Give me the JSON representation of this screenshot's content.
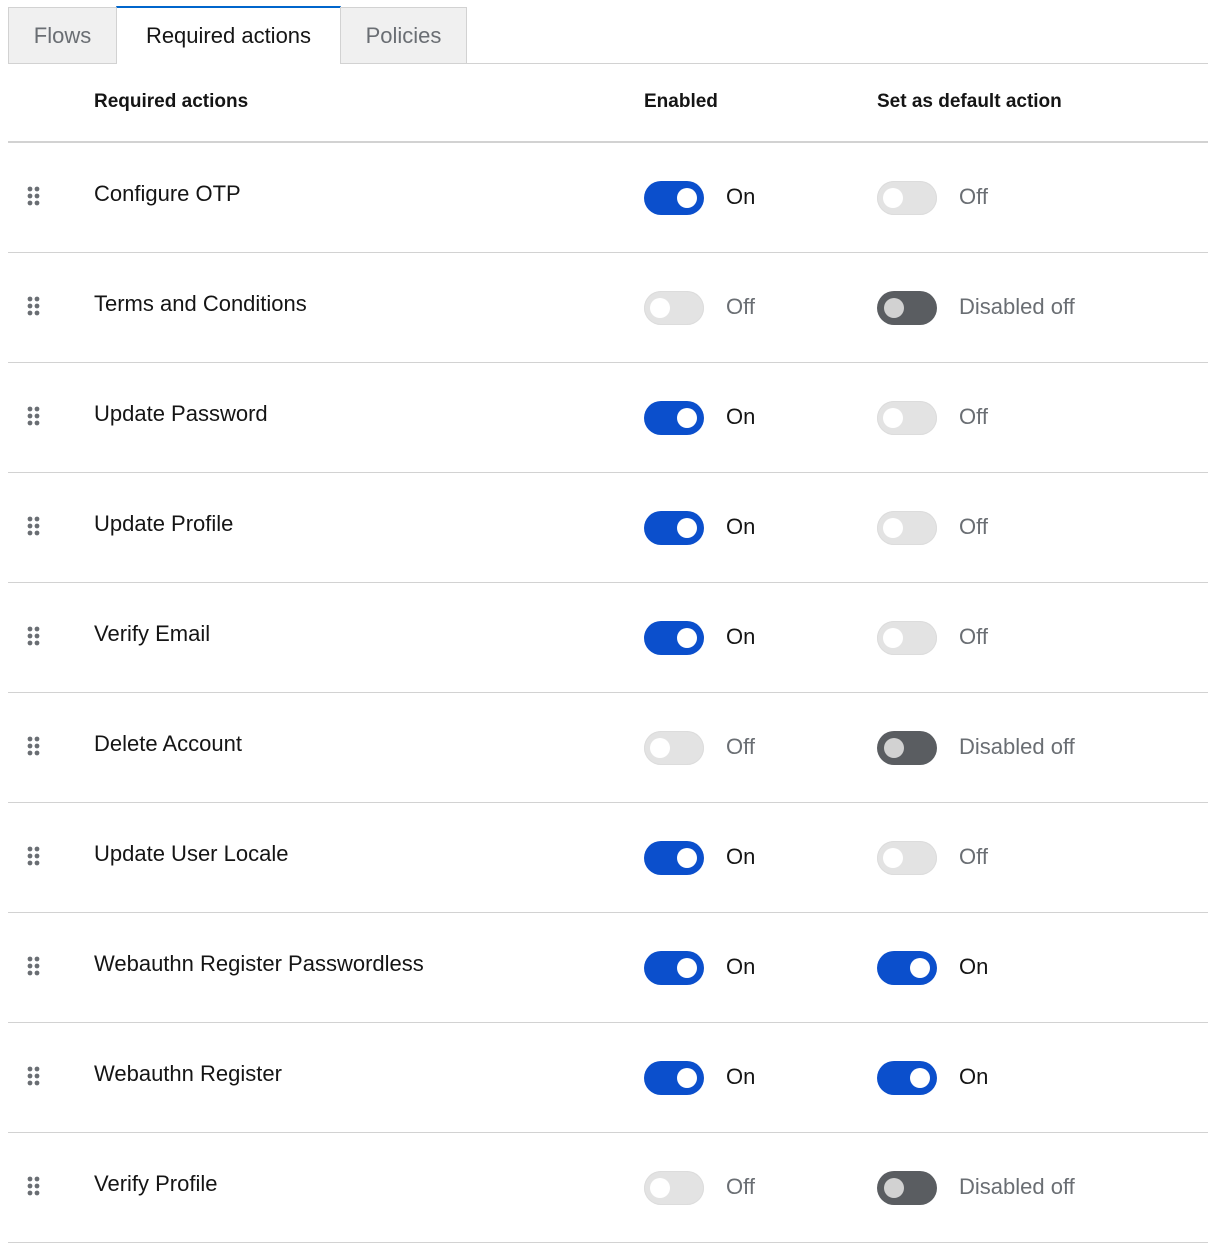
{
  "tabs": [
    {
      "label": "Flows",
      "active": false
    },
    {
      "label": "Required actions",
      "active": true
    },
    {
      "label": "Policies",
      "active": false
    }
  ],
  "table": {
    "headers": {
      "name": "Required actions",
      "enabled": "Enabled",
      "default": "Set as default action"
    },
    "rows": [
      {
        "name": "Configure OTP",
        "enabled": {
          "state": "on",
          "label": "On"
        },
        "default": {
          "state": "off",
          "label": "Off"
        }
      },
      {
        "name": "Terms and Conditions",
        "enabled": {
          "state": "off",
          "label": "Off"
        },
        "default": {
          "state": "disabled",
          "label": "Disabled off"
        }
      },
      {
        "name": "Update Password",
        "enabled": {
          "state": "on",
          "label": "On"
        },
        "default": {
          "state": "off",
          "label": "Off"
        }
      },
      {
        "name": "Update Profile",
        "enabled": {
          "state": "on",
          "label": "On"
        },
        "default": {
          "state": "off",
          "label": "Off"
        }
      },
      {
        "name": "Verify Email",
        "enabled": {
          "state": "on",
          "label": "On"
        },
        "default": {
          "state": "off",
          "label": "Off"
        }
      },
      {
        "name": "Delete Account",
        "enabled": {
          "state": "off",
          "label": "Off"
        },
        "default": {
          "state": "disabled",
          "label": "Disabled off"
        }
      },
      {
        "name": "Update User Locale",
        "enabled": {
          "state": "on",
          "label": "On"
        },
        "default": {
          "state": "off",
          "label": "Off"
        }
      },
      {
        "name": "Webauthn Register Passwordless",
        "enabled": {
          "state": "on",
          "label": "On"
        },
        "default": {
          "state": "on",
          "label": "On"
        }
      },
      {
        "name": "Webauthn Register",
        "enabled": {
          "state": "on",
          "label": "On"
        },
        "default": {
          "state": "on",
          "label": "On"
        }
      },
      {
        "name": "Verify Profile",
        "enabled": {
          "state": "off",
          "label": "Off"
        },
        "default": {
          "state": "disabled",
          "label": "Disabled off"
        }
      }
    ]
  },
  "icons": {
    "drag": "drag-handle-icon"
  },
  "colors": {
    "toggle_on": "#0b4fcc",
    "toggle_off": "#e3e3e3",
    "toggle_disabled": "#5a5d61",
    "active_tab_border": "#0066cc"
  }
}
